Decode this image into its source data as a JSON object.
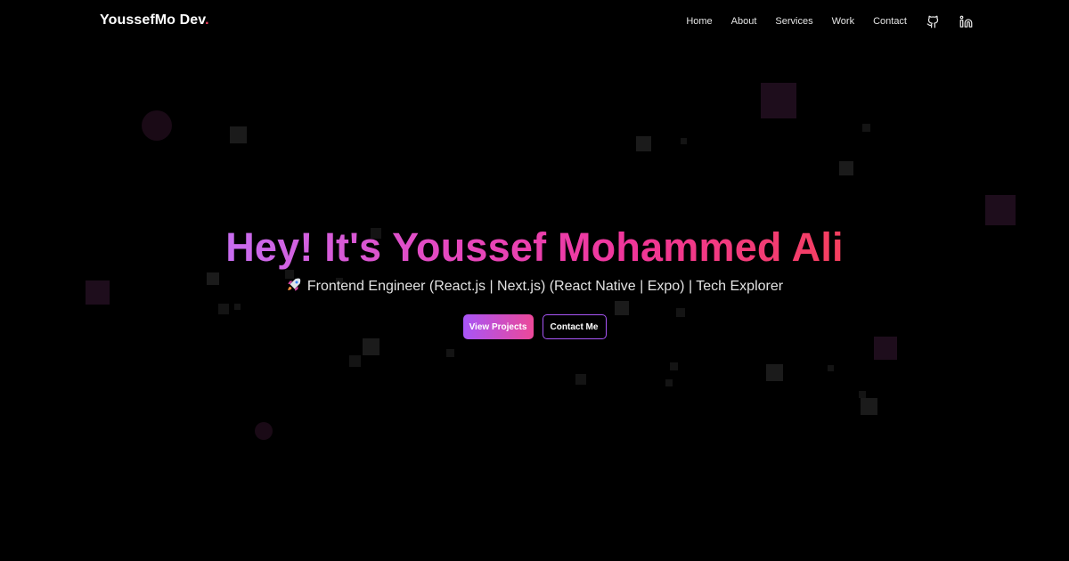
{
  "brand": {
    "name": "YoussefMo Dev",
    "dot": "."
  },
  "nav": {
    "items": [
      "Home",
      "About",
      "Services",
      "Work",
      "Contact"
    ],
    "icons": [
      "github-icon",
      "linkedin-icon"
    ]
  },
  "hero": {
    "title": "Hey! It's Youssef Mohammed Ali",
    "subtitle": "Frontend Engineer (React.js | Next.js) (React Native | Expo) | Tech Explorer",
    "subtitle_icon": "rocket-icon",
    "primary_button": "View Projects",
    "secondary_button": "Contact Me"
  },
  "colors": {
    "background": "#000000",
    "accent_purple": "#a855f7",
    "accent_pink": "#ec4899",
    "accent_rose": "#f43f5e"
  }
}
